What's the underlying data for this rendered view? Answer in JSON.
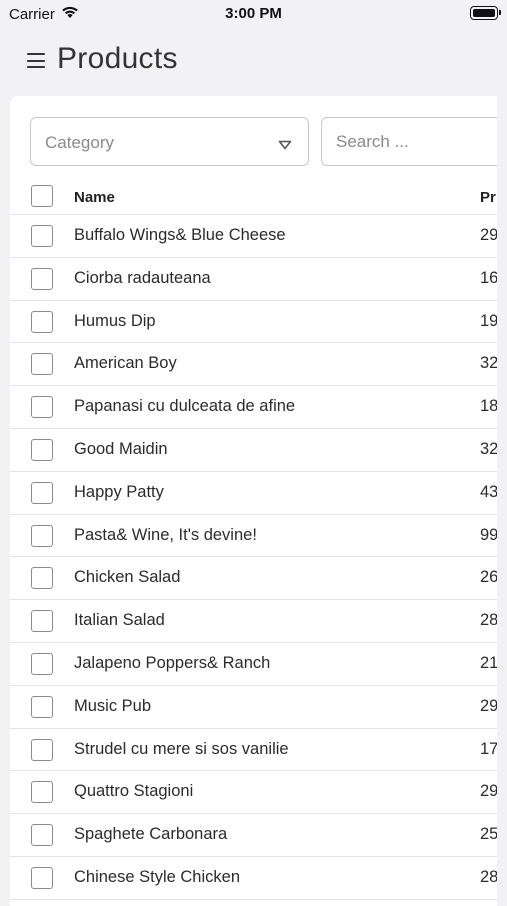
{
  "status_bar": {
    "carrier": "Carrier",
    "time": "3:00 PM"
  },
  "header": {
    "title": "Products"
  },
  "filters": {
    "category_placeholder": "Category",
    "search_placeholder": "Search ..."
  },
  "table": {
    "columns": [
      "Name",
      "Pr"
    ],
    "rows": [
      {
        "name": "Buffalo Wings& Blue Cheese",
        "price": "29"
      },
      {
        "name": "Ciorba radauteana",
        "price": "16"
      },
      {
        "name": "Humus Dip",
        "price": "19"
      },
      {
        "name": "American Boy",
        "price": "32"
      },
      {
        "name": "Papanasi cu dulceata de afine",
        "price": "18"
      },
      {
        "name": "Good Maidin",
        "price": "32"
      },
      {
        "name": "Happy Patty",
        "price": "43"
      },
      {
        "name": "Pasta& Wine, It's devine!",
        "price": "99"
      },
      {
        "name": "Chicken Salad",
        "price": "26"
      },
      {
        "name": "Italian Salad",
        "price": "28"
      },
      {
        "name": "Jalapeno Poppers& Ranch",
        "price": "21."
      },
      {
        "name": "Music Pub",
        "price": "29"
      },
      {
        "name": "Strudel cu mere si sos vanilie",
        "price": "17."
      },
      {
        "name": "Quattro Stagioni",
        "price": "29"
      },
      {
        "name": "Spaghete Carbonara",
        "price": "25"
      },
      {
        "name": "Chinese Style Chicken",
        "price": "28"
      }
    ]
  }
}
